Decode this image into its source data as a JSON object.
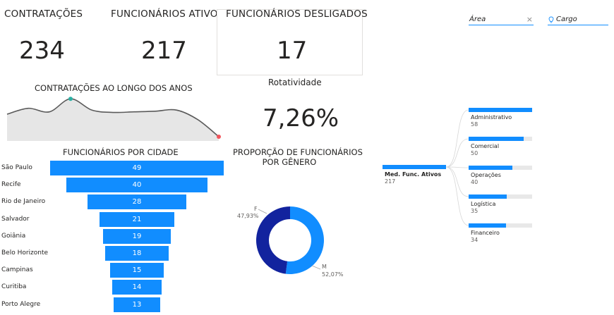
{
  "kpis": {
    "contratacoes": {
      "title": "CONTRATAÇÕES",
      "value": "234"
    },
    "ativos": {
      "title": "FUNCIONÁRIOS ATIVOS",
      "value": "217"
    },
    "desligados": {
      "title": "FUNCIONÁRIOS DESLIGADOS",
      "value": "17"
    }
  },
  "rotatividade": {
    "title": "Rotatividade",
    "value": "7,26%"
  },
  "slicers": {
    "area": {
      "label": "Área",
      "clear": "×"
    },
    "cargo": {
      "label": "Cargo"
    }
  },
  "line_chart": {
    "title": "CONTRATAÇÕES AO LONGO DOS ANOS"
  },
  "funnel": {
    "title": "FUNCIONÁRIOS POR CIDADE"
  },
  "donut": {
    "title_line1": "PROPORÇÃO DE FUNCIONÁRIOS",
    "title_line2": "POR GÊNERO"
  },
  "tree": {
    "root_name": "Med. Func. Ativos",
    "root_value": "217"
  },
  "chart_data": [
    {
      "type": "area",
      "title": "CONTRATAÇÕES AO LONGO DOS ANOS",
      "series": [
        {
          "values": [
            0.38,
            0.58,
            0.46,
            0.9,
            0.52,
            0.44,
            0.46,
            0.48,
            0.52,
            0.2,
            -0.38
          ]
        }
      ],
      "highlight_points": [
        {
          "index": 3,
          "color": "#2bb0a4"
        },
        {
          "index": 10,
          "color": "#f2545b"
        }
      ],
      "line_color": "#5a5a5a",
      "fill_color": "#e6e6e6"
    },
    {
      "type": "bar",
      "title": "FUNCIONÁRIOS POR CIDADE",
      "categories": [
        "São Paulo",
        "Recife",
        "Rio de Janeiro",
        "Salvador",
        "Goiânia",
        "Belo Horizonte",
        "Campinas",
        "Curitiba",
        "Porto Alegre"
      ],
      "values": [
        49,
        40,
        28,
        21,
        19,
        18,
        15,
        14,
        13
      ],
      "value_labels": [
        "49",
        "40",
        "28",
        "21",
        "19",
        "18",
        "15",
        "14",
        "13"
      ],
      "color": "#118dff"
    },
    {
      "type": "pie",
      "title": "PROPORÇÃO DE FUNCIONÁRIOS POR GÊNERO",
      "categories": [
        "F",
        "M"
      ],
      "values": [
        47.93,
        52.07
      ],
      "value_labels": [
        "47,93%",
        "52,07%"
      ],
      "colors": [
        "#12239e",
        "#118dff"
      ]
    },
    {
      "type": "bar",
      "title": "Med. Func. Ativos",
      "categories": [
        "Administrativo",
        "Comercial",
        "Operações",
        "Logística",
        "Financeiro"
      ],
      "values": [
        58,
        50,
        40,
        35,
        34
      ],
      "value_labels": [
        "58",
        "50",
        "40",
        "35",
        "34"
      ],
      "color": "#118dff"
    }
  ]
}
